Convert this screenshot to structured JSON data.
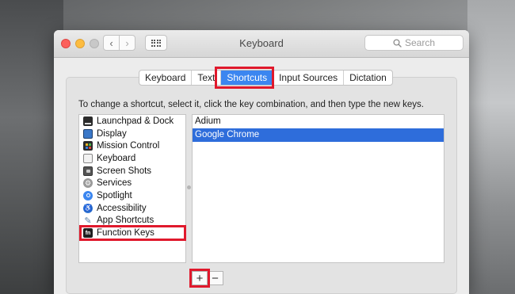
{
  "window": {
    "title": "Keyboard",
    "search_placeholder": "Search"
  },
  "tabs": [
    {
      "label": "Keyboard",
      "active": false
    },
    {
      "label": "Text",
      "active": false
    },
    {
      "label": "Shortcuts",
      "active": true
    },
    {
      "label": "Input Sources",
      "active": false
    },
    {
      "label": "Dictation",
      "active": false
    }
  ],
  "instructions": "To change a shortcut, select it, click the key combination, and then type the new keys.",
  "categories": [
    {
      "label": "Launchpad & Dock",
      "icon": "launchpad-dock-icon"
    },
    {
      "label": "Display",
      "icon": "display-icon"
    },
    {
      "label": "Mission Control",
      "icon": "mission-control-icon"
    },
    {
      "label": "Keyboard",
      "icon": "keyboard-icon"
    },
    {
      "label": "Screen Shots",
      "icon": "screen-shots-icon"
    },
    {
      "label": "Services",
      "icon": "services-gear-icon"
    },
    {
      "label": "Spotlight",
      "icon": "spotlight-icon"
    },
    {
      "label": "Accessibility",
      "icon": "accessibility-icon"
    },
    {
      "label": "App Shortcuts",
      "icon": "app-shortcuts-icon"
    },
    {
      "label": "Function Keys",
      "icon": "function-keys-icon"
    }
  ],
  "apps": [
    {
      "label": "Adium",
      "selected": false
    },
    {
      "label": "Google Chrome",
      "selected": true
    }
  ],
  "buttons": {
    "add": "+",
    "remove": "−"
  },
  "colors": {
    "accent": "#3b86f0",
    "selection": "#2e6ddb",
    "annotation": "#e0192c"
  }
}
